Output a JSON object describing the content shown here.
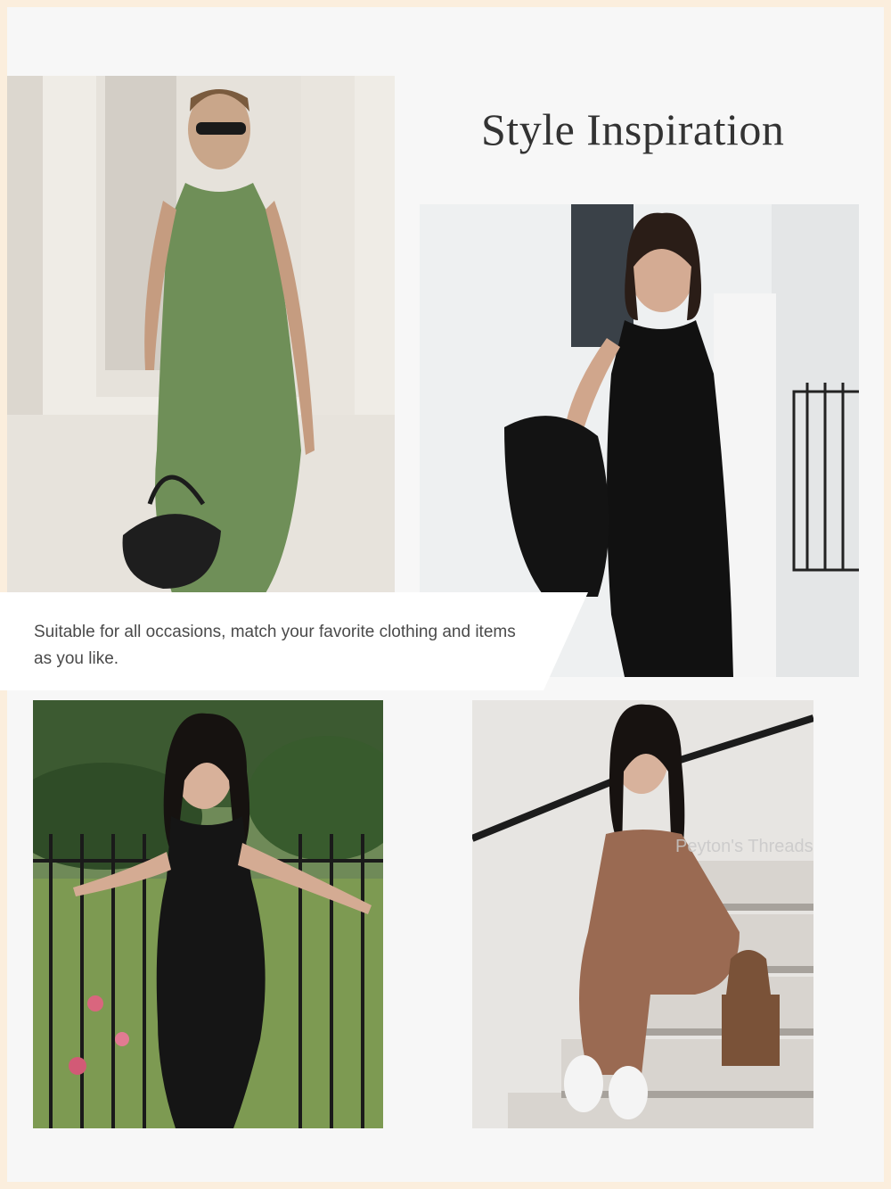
{
  "heading": "Style Inspiration",
  "caption": "Suitable for all occasions, match your favorite clothing and items as you like.",
  "watermark": "Peyton's Threads",
  "photos": [
    {
      "label": "green-bodycon-dress-photo",
      "dress_color": "#6f8f58"
    },
    {
      "label": "black-sleeveless-dress-photo",
      "dress_color": "#111111"
    },
    {
      "label": "black-dress-garden-photo",
      "dress_color": "#151515"
    },
    {
      "label": "brown-dress-stairs-photo",
      "dress_color": "#9a6a52"
    }
  ],
  "colors": {
    "page_border": "#fbeedd",
    "card_background": "#f7f7f7",
    "heading_text": "#333333",
    "caption_text": "#4a4a4a"
  }
}
